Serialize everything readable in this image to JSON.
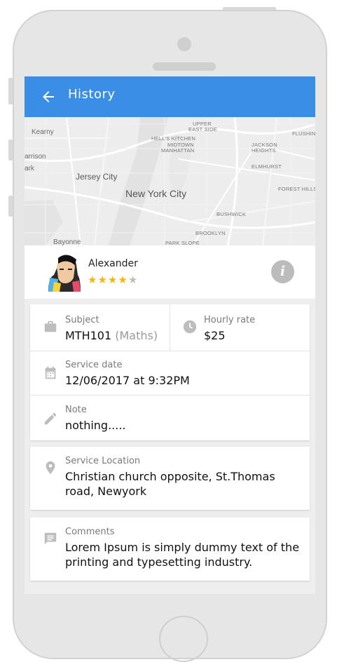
{
  "appbar": {
    "title": "History",
    "back_icon": "arrow-back-icon"
  },
  "map": {
    "labels": {
      "kearny": "Kearny",
      "harrison": "arrison",
      "park": "ark",
      "jersey_city": "Jersey City",
      "new_york_city": "New York City",
      "bayonne": "Bayonne",
      "upper_east_side_1": "UPPER",
      "upper_east_side_2": "EAST SIDE",
      "hells_kitchen": "HELL'S KITCHEN",
      "midtown_1": "MIDTOWN",
      "midtown_2": "MANHATTAN",
      "jackson_heights_1": "JACKSON",
      "jackson_heights_2": "HEIGHTS",
      "flushing": "FLUSHING",
      "elmhurst": "ELMHURST",
      "forest_hills": "FOREST HILLS",
      "bushwick": "BUSHWICK",
      "brooklyn": "BROOKLYN",
      "park_slope": "PARK SLOPE"
    }
  },
  "profile": {
    "name": "Alexander",
    "rating": 4,
    "rating_max": 5,
    "info_label": "i"
  },
  "details": {
    "subject_label": "Subject",
    "subject_code": "MTH101",
    "subject_name": "(Maths)",
    "rate_label": "Hourly rate",
    "rate_value": "$25",
    "date_label": "Service date",
    "date_value": "12/06/2017 at 9:32PM",
    "note_label": "Note",
    "note_value": "nothing.....",
    "location_label": "Service Location",
    "location_value": "Christian church opposite, St.Thomas road, Newyork",
    "comments_label": "Comments",
    "comments_value": "Lorem Ipsum is simply dummy text of the printing and typesetting industry."
  },
  "colors": {
    "appbar": "#3a8ee6",
    "star": "#f5b800",
    "icon": "#bdbdbd"
  }
}
